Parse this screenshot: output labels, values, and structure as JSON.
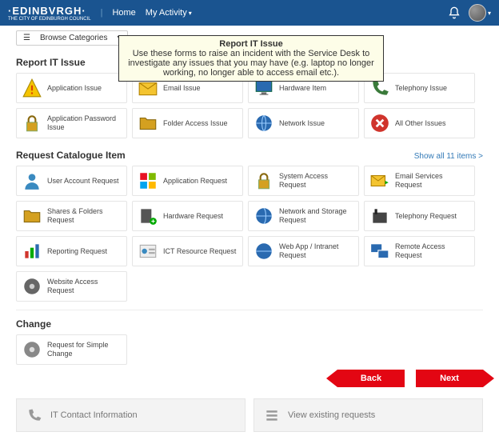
{
  "header": {
    "brand": "·EDINBVRGH·",
    "brand_sub": "THE CITY OF EDINBURGH COUNCIL",
    "nav_home": "Home",
    "nav_activity": "My Activity"
  },
  "filter": {
    "browse_label": "Browse Categories"
  },
  "callout": {
    "title": "Report IT Issue",
    "body": "Use these forms to raise an incident with the Service Desk to investigate any issues that you may have (e.g. laptop no longer working, no longer able to access email etc.)."
  },
  "sections": {
    "report": {
      "title": "Report IT Issue",
      "items": [
        {
          "label": "Application Issue"
        },
        {
          "label": "Email Issue"
        },
        {
          "label": "Hardware Item"
        },
        {
          "label": "Telephony Issue"
        },
        {
          "label": "Application Password Issue"
        },
        {
          "label": "Folder Access Issue"
        },
        {
          "label": "Network Issue"
        },
        {
          "label": "All Other Issues"
        }
      ]
    },
    "catalogue": {
      "title": "Request Catalogue Item",
      "show_all": "Show all 11 items >",
      "items": [
        {
          "label": "User Account Request"
        },
        {
          "label": "Application Request"
        },
        {
          "label": "System Access Request"
        },
        {
          "label": "Email Services Request"
        },
        {
          "label": "Shares & Folders Request"
        },
        {
          "label": "Hardware Request"
        },
        {
          "label": "Network and Storage Request"
        },
        {
          "label": "Telephony Request"
        },
        {
          "label": "Reporting Request"
        },
        {
          "label": "ICT Resource Request"
        },
        {
          "label": "Web App / Intranet Request"
        },
        {
          "label": "Remote Access Request"
        },
        {
          "label": "Website Access Request"
        }
      ]
    },
    "change": {
      "title": "Change",
      "items": [
        {
          "label": "Request for Simple Change"
        }
      ]
    }
  },
  "nav_buttons": {
    "back": "Back",
    "next": "Next"
  },
  "footer": {
    "contact": "IT Contact Information",
    "existing": "View existing requests"
  }
}
